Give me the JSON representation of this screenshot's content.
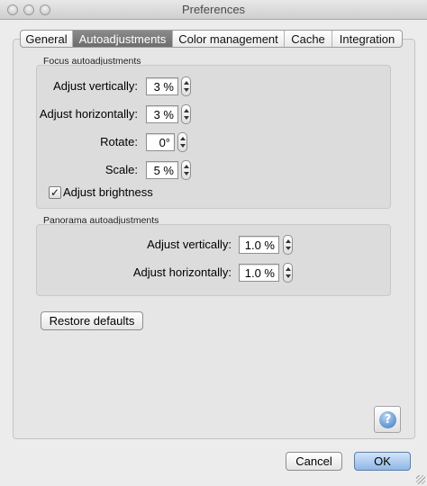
{
  "window": {
    "title": "Preferences"
  },
  "tabs": [
    {
      "label": "General",
      "active": false
    },
    {
      "label": "Autoadjustments",
      "active": true
    },
    {
      "label": "Color management",
      "active": false
    },
    {
      "label": "Cache",
      "active": false
    },
    {
      "label": "Integration",
      "active": false
    }
  ],
  "focus": {
    "group_label": "Focus autoadjustments",
    "adjust_vertically": {
      "label": "Adjust vertically:",
      "value": "3 %"
    },
    "adjust_horizontally": {
      "label": "Adjust horizontally:",
      "value": "3 %"
    },
    "rotate": {
      "label": "Rotate:",
      "value": "0°"
    },
    "scale": {
      "label": "Scale:",
      "value": "5 %"
    },
    "adjust_brightness": {
      "label": "Adjust brightness",
      "checked": true,
      "mark": "✓"
    }
  },
  "panorama": {
    "group_label": "Panorama autoadjustments",
    "adjust_vertically": {
      "label": "Adjust vertically:",
      "value": "1.0 %"
    },
    "adjust_horizontally": {
      "label": "Adjust horizontally:",
      "value": "1.0 %"
    }
  },
  "buttons": {
    "restore_defaults": "Restore defaults",
    "cancel": "Cancel",
    "ok": "OK",
    "help": "?"
  },
  "colors": {
    "active_tab": "#7a7a7a",
    "default_button": "#8fb7e6"
  }
}
